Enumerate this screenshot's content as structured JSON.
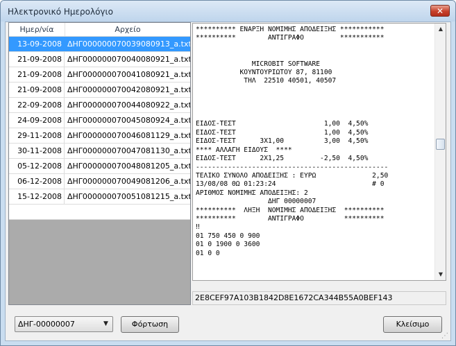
{
  "window": {
    "title": "Ηλεκτρονικό Ημερολόγιο",
    "close_glyph": "✕"
  },
  "list": {
    "columns": [
      "Ημερ/νία",
      "Αρχείο"
    ],
    "rows": [
      {
        "date": "13-09-2008",
        "file": "ΔΗΓ000000070039080913_a.txt",
        "selected": true
      },
      {
        "date": "21-09-2008",
        "file": "ΔΗΓ000000070040080921_a.txt"
      },
      {
        "date": "21-09-2008",
        "file": "ΔΗΓ000000070041080921_a.txt"
      },
      {
        "date": "21-09-2008",
        "file": "ΔΗΓ000000070042080921_a.txt"
      },
      {
        "date": "22-09-2008",
        "file": "ΔΗΓ000000070044080922_a.txt"
      },
      {
        "date": "24-09-2008",
        "file": "ΔΗΓ000000070045080924_a.txt"
      },
      {
        "date": "29-11-2008",
        "file": "ΔΗΓ000000070046081129_a.txt"
      },
      {
        "date": "30-11-2008",
        "file": "ΔΗΓ000000070047081130_a.txt"
      },
      {
        "date": "05-12-2008",
        "file": "ΔΗΓ000000070048081205_a.txt"
      },
      {
        "date": "06-12-2008",
        "file": "ΔΗΓ000000070049081206_a.txt"
      },
      {
        "date": "15-12-2008",
        "file": "ΔΗΓ000000070051081215_a.txt"
      }
    ]
  },
  "receipt": {
    "lines": [
      "********** ΕΝΑΡΞΗ ΝΟΜΙΜΗΣ ΑΠΟΔΕΙΞΗΣ ***********",
      "**********        ΑΝΤΙΓΡΑΦΟ         ***********",
      "",
      "",
      "              MICROBIT SOFTWARE",
      "           ΚΟΥΝΤΟΥΡΙΩΤΟΥ 87, 81100",
      "            ΤΗΛ  22510 40501, 40507",
      "",
      "",
      "",
      "",
      "ΕΙΔΟΣ-ΤΕΣΤ                      1,00  4,50%",
      "ΕΙΔΟΣ-ΤΕΣΤ                      1,00  4,50%",
      "ΕΙΔΟΣ-ΤΕΣΤ      3Χ1,00          3,00  4,50%",
      "**** ΑΛΛΑΓΗ ΕΙΔΟΥΣ  ****",
      "ΕΙΔΟΣ-ΤΕΣΤ      2Χ1,25         -2,50  4,50%",
      "------------------------------------------------",
      "ΤΕΛΙΚΟ ΣΥΝΟΛΟ ΑΠΟΔΕΙΞΗΣ : ΕΥΡΩ              2,50",
      "13/08/08 ΘΩ 01:23:24                        # 0",
      "ΑΡΙΘΜΟΣ ΝΟΜΙΜΗΣ ΑΠΟΔΕΙΞΗΣ: 2",
      "                  ΔΗΓ 00000007",
      "**********  ΛΗΞΗ  ΝΟΜΙΜΗΣ ΑΠΟΔΕΙΞΗΣ  **********",
      "**********        ΑΝΤΙΓΡΑΦΟ          **********",
      "‼",
      "01 750 450 0 900",
      "01 0 1900 0 3600",
      "01 0 0"
    ]
  },
  "scrollbar": {
    "up_glyph": "▲",
    "down_glyph": "▼"
  },
  "hash_text": "2E8CEF97A103B1842D8E1672CA344B55A0BEF143",
  "footer": {
    "combo_value": "ΔΗΓ-00000007",
    "combo_arrow": "▼",
    "load_label": "Φόρτωση",
    "close_label": "Κλείσιμο"
  }
}
